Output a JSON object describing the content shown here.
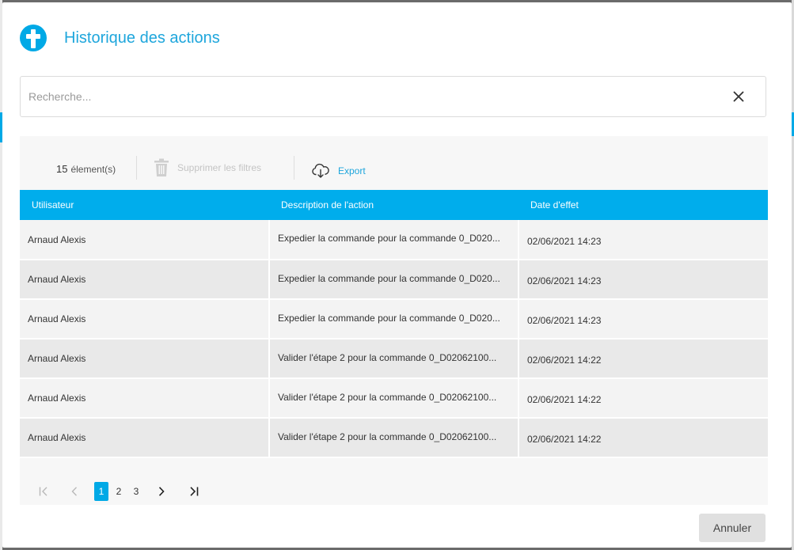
{
  "dialog": {
    "title": "Historique des actions",
    "search_placeholder": "Recherche...",
    "search_value": ""
  },
  "toolbar": {
    "count": "15",
    "count_unit": "élement(s)",
    "clear_filters_label": "Supprimer les filtres",
    "export_label": "Export"
  },
  "table": {
    "columns": [
      "Utilisateur",
      "Description de l'action",
      "Date d'effet"
    ],
    "rows": [
      {
        "user": "Arnaud Alexis",
        "description": "Expedier la commande pour la commande 0_D020...",
        "date": "02/06/2021 14:23"
      },
      {
        "user": "Arnaud Alexis",
        "description": "Expedier la commande pour la commande 0_D020...",
        "date": "02/06/2021 14:23"
      },
      {
        "user": "Arnaud Alexis",
        "description": "Expedier la commande pour la commande 0_D020...",
        "date": "02/06/2021 14:23"
      },
      {
        "user": "Arnaud Alexis",
        "description": "Valider l'étape 2 pour la commande 0_D02062100...",
        "date": "02/06/2021 14:22"
      },
      {
        "user": "Arnaud Alexis",
        "description": "Valider l'étape 2 pour la commande 0_D02062100...",
        "date": "02/06/2021 14:22"
      },
      {
        "user": "Arnaud Alexis",
        "description": "Valider l'étape 2 pour la commande 0_D02062100...",
        "date": "02/06/2021 14:22"
      }
    ]
  },
  "pagination": {
    "pages": [
      "1",
      "2",
      "3"
    ],
    "current": "1"
  },
  "footer": {
    "cancel_label": "Annuler"
  },
  "colors": {
    "accent": "#00adec",
    "title": "#1ea6dc"
  }
}
